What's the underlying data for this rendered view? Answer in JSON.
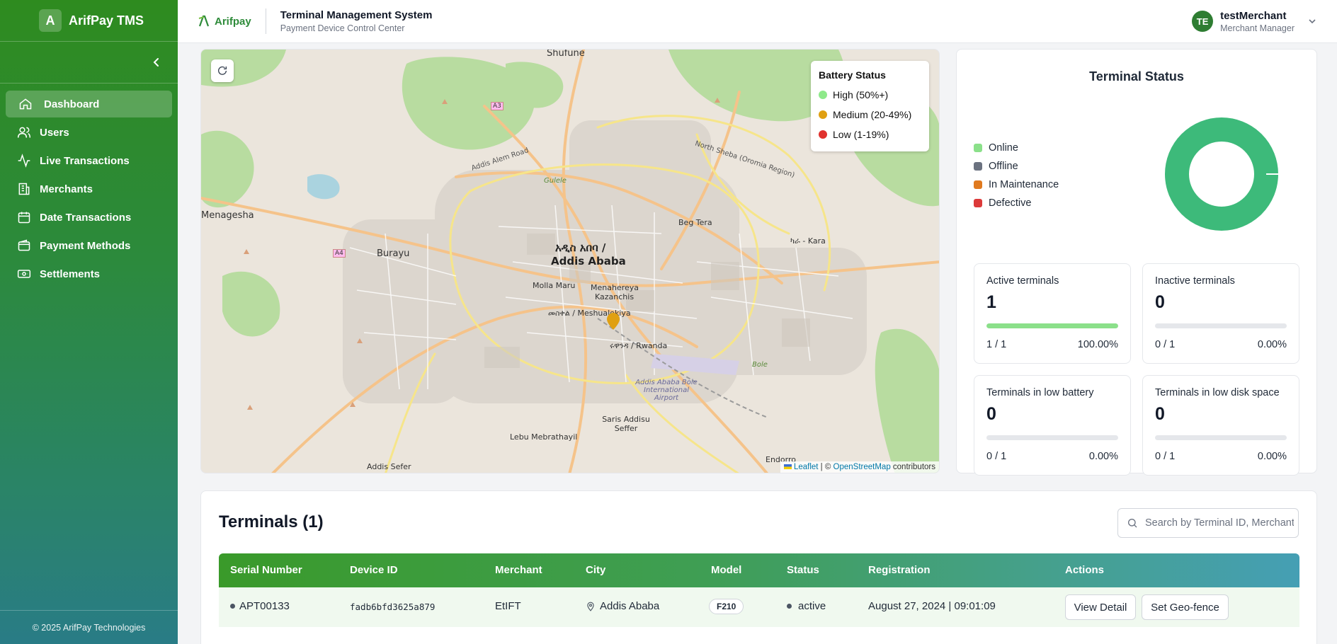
{
  "sidebar": {
    "brand_letter": "A",
    "brand_name": "ArifPay TMS",
    "items": [
      {
        "label": "Dashboard",
        "icon": "home-icon",
        "active": true
      },
      {
        "label": "Users",
        "icon": "users-icon"
      },
      {
        "label": "Live Transactions",
        "icon": "activity-icon"
      },
      {
        "label": "Merchants",
        "icon": "building-icon"
      },
      {
        "label": "Date Transactions",
        "icon": "calendar-icon"
      },
      {
        "label": "Payment Methods",
        "icon": "wallet-icon"
      },
      {
        "label": "Settlements",
        "icon": "banknote-icon"
      }
    ],
    "footer": "© 2025 ArifPay Technologies"
  },
  "header": {
    "logo_text": "Arifpay",
    "title": "Terminal Management System",
    "subtitle": "Payment Device Control Center",
    "user": {
      "initials": "TE",
      "name": "testMerchant",
      "role": "Merchant Manager"
    }
  },
  "map": {
    "legend_title": "Battery Status",
    "legend": [
      {
        "label": "High (50%+)",
        "color": "#8ee98a"
      },
      {
        "label": "Medium (20-49%)",
        "color": "#e0a012"
      },
      {
        "label": "Low (1-19%)",
        "color": "#e0322e"
      }
    ],
    "labels": {
      "city_amharic": "አዲስ አበባ /",
      "city": "Addis Ababa",
      "shufune": "Shufune",
      "menagesha": "Menagesha",
      "burayu": "Burayu",
      "beg_tera": "Beg Tera",
      "molla_maru": "Molla Maru",
      "menahereya": "Menahereya",
      "kazanchis": "Kazanchis",
      "meshualekiya": "መስቀል / Meshualekiya",
      "rwanda": "ሩዋንዳ / Rwanda",
      "airport": "Addis Ababa Bole International Airport",
      "saris": "Saris Addisu Seffer",
      "lebu": "Lebu Mebrathayil",
      "addis_sefer": "Addis Sefer",
      "endorro": "Endorro",
      "a3": "A3",
      "a4": "A4",
      "gulele": "Gulele",
      "bole": "Bole",
      "karakore": "ካራ - Kara",
      "ring": "North Sheba (Oromia Region)",
      "addis_alem_road": "Addis Alem Road"
    },
    "attribution_leaflet": "Leaflet",
    "attribution_mid": " | © ",
    "attribution_osm": "OpenStreetMap",
    "attribution_tail": " contributors"
  },
  "terminal_status": {
    "title": "Terminal Status",
    "legend": [
      {
        "label": "Online",
        "color": "#8be08a"
      },
      {
        "label": "Offline",
        "color": "#6b7280"
      },
      {
        "label": "In Maintenance",
        "color": "#e07a1f"
      },
      {
        "label": "Defective",
        "color": "#dc3a3a"
      }
    ],
    "donut_color": "#3dba7a",
    "stats": [
      {
        "label": "Active terminals",
        "value": "1",
        "ratio": "1 / 1",
        "percent": "100.00%",
        "fill": 1.0
      },
      {
        "label": "Inactive terminals",
        "value": "0",
        "ratio": "0 / 1",
        "percent": "0.00%",
        "fill": 0
      },
      {
        "label": "Terminals in low battery",
        "value": "0",
        "ratio": "0 / 1",
        "percent": "0.00%",
        "fill": 0
      },
      {
        "label": "Terminals in low disk space",
        "value": "0",
        "ratio": "0 / 1",
        "percent": "0.00%",
        "fill": 0
      }
    ]
  },
  "terminals": {
    "title": "Terminals (1)",
    "search_placeholder": "Search by Terminal ID, Merchant",
    "columns": [
      "Serial Number",
      "Device ID",
      "Merchant",
      "City",
      "Model",
      "Status",
      "Registration",
      "Actions"
    ],
    "rows": [
      {
        "serial": "APT00133",
        "device_id": "fadb6bfd3625a879",
        "merchant": "EtIFT",
        "city": "Addis Ababa",
        "model": "F210",
        "status": "active",
        "registration": "August 27, 2024 | 09:01:09",
        "actions": [
          "View Detail",
          "Set Geo-fence"
        ]
      }
    ]
  }
}
